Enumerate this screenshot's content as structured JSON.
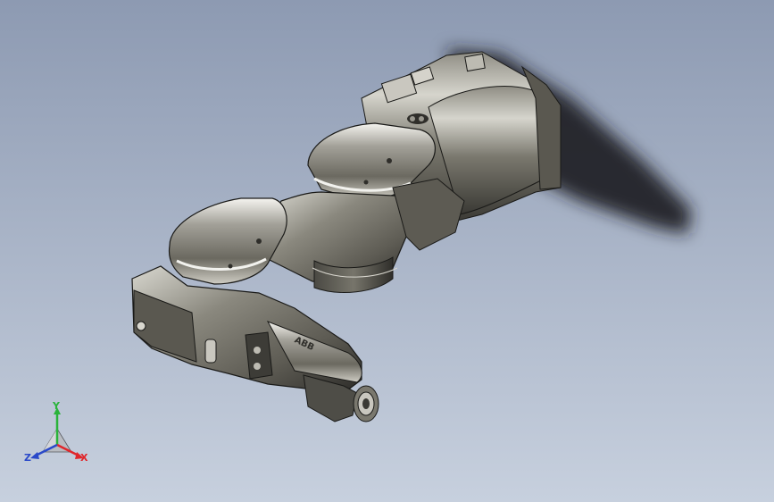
{
  "viewport": {
    "background_top": "#8d9ab2",
    "background_bottom": "#c7d0de"
  },
  "model": {
    "part_color": "#6f6d64",
    "highlight_color": "#f2f2ee",
    "shadow_color": "#1e1f22",
    "logo_text": "ABB"
  },
  "triad": {
    "x_label": "X",
    "y_label": "Y",
    "z_label": "Z",
    "x_color": "#e0262b",
    "y_color": "#29b33a",
    "z_color": "#2a49c9"
  }
}
